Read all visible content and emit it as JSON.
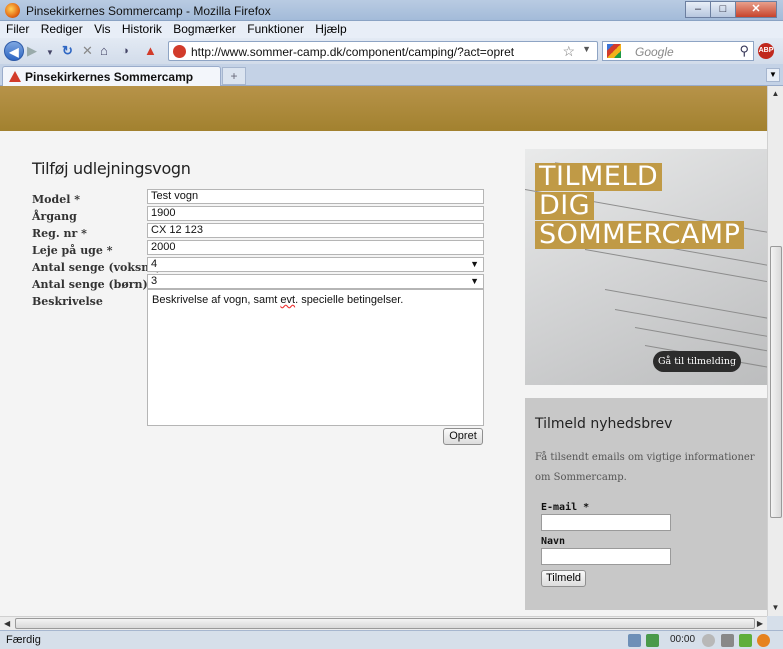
{
  "browser": {
    "window_title": "Pinsekirkernes Sommercamp - Mozilla Firefox",
    "menu": [
      "Filer",
      "Rediger",
      "Vis",
      "Historik",
      "Bogmærker",
      "Funktioner",
      "Hjælp"
    ],
    "url": "http://www.sommer-camp.dk/component/camping/?act=opret",
    "search_placeholder": "Google",
    "tab_title": "Pinsekirkernes Sommercamp",
    "status_text": "Færdig",
    "status_time": "00:00"
  },
  "page": {
    "heading": "Tilføj udlejningsvogn",
    "fields": [
      {
        "label": "Model *",
        "value": "Test vogn"
      },
      {
        "label": "Årgang",
        "value": "1900"
      },
      {
        "label": "Reg. nr *",
        "value": "CX 12 123"
      },
      {
        "label": "Leje på uge *",
        "value": "2000"
      },
      {
        "label": "Antal senge (voksne)",
        "value": "4"
      },
      {
        "label": "Antal senge (børn)",
        "value": "3"
      }
    ],
    "description_label": "Beskrivelse",
    "description_pre": "Beskrivelse af vogn, samt ",
    "description_misspelled": "evt",
    "description_post": ". specielle betingelser.",
    "submit_label": "Opret"
  },
  "promo": {
    "line1": "TILMELD",
    "line2": "DIG",
    "line3": "SOMMERCAMP",
    "button": "Gå til tilmelding"
  },
  "newsletter": {
    "title": "Tilmeld nyhedsbrev",
    "description": "Få tilsendt emails om vigtige informationer om Sommercamp.",
    "email_label": "E-mail *",
    "name_label": "Navn",
    "button": "Tilmeld"
  },
  "colors": {
    "banner": "#b08c3f",
    "accent": "#c09a46"
  }
}
